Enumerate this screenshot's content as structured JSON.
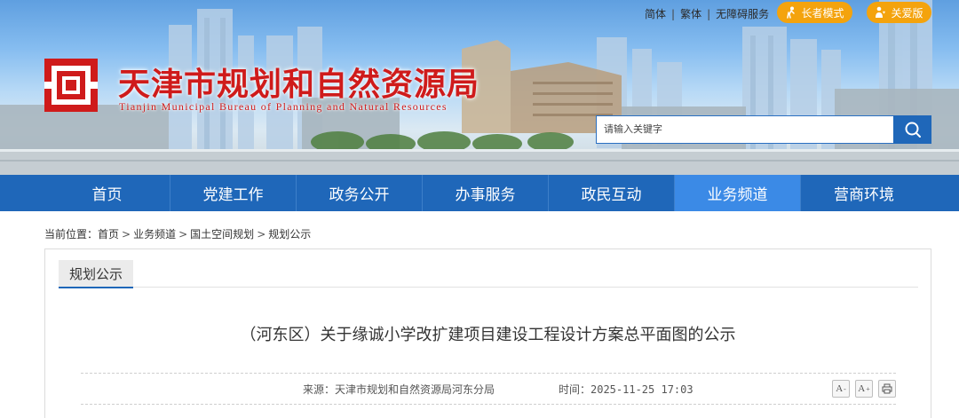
{
  "header": {
    "links": [
      "简体",
      "繁体",
      "无障碍服务"
    ],
    "elder_mode_label": "长者模式",
    "care_label": "关爱版",
    "site_title": "天津市规划和自然资源局",
    "site_subtitle": "Tianjin Municipal Bureau of Planning and Natural Resources",
    "search_placeholder": "请输入关键字"
  },
  "nav": {
    "items": [
      {
        "label": "首页",
        "active": false
      },
      {
        "label": "党建工作",
        "active": false
      },
      {
        "label": "政务公开",
        "active": false
      },
      {
        "label": "办事服务",
        "active": false
      },
      {
        "label": "政民互动",
        "active": false
      },
      {
        "label": "业务频道",
        "active": true
      },
      {
        "label": "营商环境",
        "active": false
      }
    ]
  },
  "breadcrumb": {
    "prefix": "当前位置：",
    "items": [
      "首页",
      "业务频道",
      "国土空间规划",
      "规划公示"
    ]
  },
  "content": {
    "tab_label": "规划公示",
    "article_title": "（河东区）关于缘诚小学改扩建项目建设工程设计方案总平面图的公示",
    "source": "来源：天津市规划和自然资源局河东分局",
    "time": "时间：2025-11-25 17:03",
    "font_decrease_label": "A",
    "font_increase_label": "A",
    "font_decrease_sign": "-",
    "font_increase_sign": "+"
  },
  "colors": {
    "nav_bg": "#1f67b9",
    "nav_active": "#3b8ae6",
    "brand_red": "#cf1b1b",
    "pill_orange": "#f4a30d"
  },
  "icons": [
    "elder-icon",
    "care-icon",
    "logo-icon",
    "search-icon",
    "print-icon"
  ]
}
